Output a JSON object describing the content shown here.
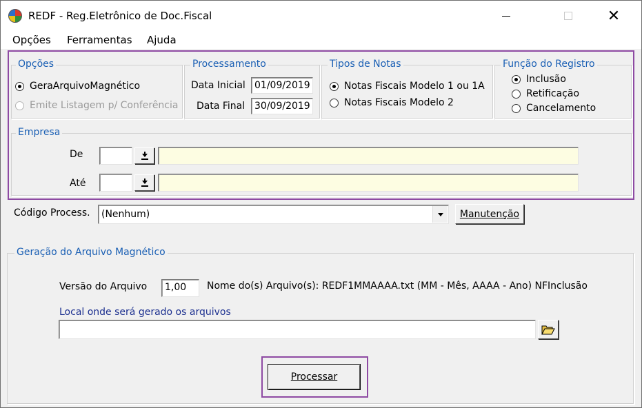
{
  "window": {
    "title": "REDF - Reg.Eletrônico de Doc.Fiscal",
    "icon": "app-globe-icon"
  },
  "menu": [
    "Opções",
    "Ferramentas",
    "Ajuda"
  ],
  "opcoes": {
    "legend": "Opções",
    "options": [
      {
        "label": "GeraArquivoMagnético",
        "checked": true,
        "enabled": true
      },
      {
        "label": "Emite Listagem p/ Conferência",
        "checked": false,
        "enabled": false
      }
    ]
  },
  "processamento": {
    "legend": "Processamento",
    "data_inicial_label": "Data Inicial",
    "data_inicial_value": "01/09/2019",
    "data_final_label": "Data Final",
    "data_final_value": "30/09/2019"
  },
  "tipos_notas": {
    "legend": "Tipos de Notas",
    "options": [
      {
        "label": "Notas Fiscais Modelo 1 ou 1A",
        "checked": true
      },
      {
        "label": "Notas Fiscais Modelo 2",
        "checked": false
      }
    ]
  },
  "funcao_registro": {
    "legend": "Função do Registro",
    "options": [
      {
        "label": "Inclusão",
        "checked": true
      },
      {
        "label": "Retificação",
        "checked": false
      },
      {
        "label": "Cancelamento",
        "checked": false
      }
    ]
  },
  "empresa": {
    "legend": "Empresa",
    "de_label": "De",
    "de_code": "",
    "de_name": "",
    "ate_label": "Até",
    "ate_code": "",
    "ate_name": ""
  },
  "codigo_process": {
    "label": "Código Process.",
    "value": "(Nenhum)",
    "manutencao_label": "Manutenção"
  },
  "geracao": {
    "legend": "Geração do Arquivo Magnético",
    "versao_label": "Versão do Arquivo",
    "versao_value": "1,00",
    "nome_arquivo_text": "Nome do(s) Arquivo(s): REDF1MMAAAA.txt (MM - Mês,  AAAA - Ano) NFInclusão",
    "local_label": "Local onde será gerado os arquivos",
    "local_value": "",
    "processar_label": "Processar"
  },
  "colors": {
    "highlight": "#8e4aa3",
    "legend_blue": "#1a5fb4",
    "field_yellow": "#fdfde2"
  }
}
